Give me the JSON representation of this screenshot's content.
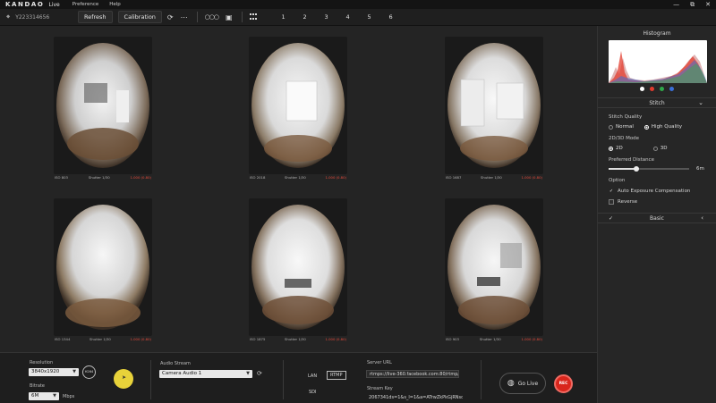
{
  "app": {
    "logo": "KANDAO",
    "product": "Live"
  },
  "menu": [
    "Preference",
    "Help"
  ],
  "window_controls": [
    "minimize-icon",
    "restore-icon",
    "close-icon"
  ],
  "toolbar": {
    "device_id": "Y223314656",
    "refresh_label": "Refresh",
    "calibration_label": "Calibration",
    "camera_tabs": [
      "1",
      "2",
      "3",
      "4",
      "5",
      "6"
    ]
  },
  "cameras": [
    {
      "iso": "ISO 803",
      "shutter": "Shutter 1/30",
      "status": "1.000 (0.80)"
    },
    {
      "iso": "ISO 2018",
      "shutter": "Shutter 1/30",
      "status": "1.000 (0.80)"
    },
    {
      "iso": "ISO 1687",
      "shutter": "Shutter 1/30",
      "status": "1.000 (0.80)"
    },
    {
      "iso": "ISO 1344",
      "shutter": "Shutter 1/30",
      "status": "1.000 (0.80)"
    },
    {
      "iso": "ISO 1875",
      "shutter": "Shutter 1/30",
      "status": "1.000 (0.80)"
    },
    {
      "iso": "ISO 903",
      "shutter": "Shutter 1/30",
      "status": "1.000 (0.80)"
    }
  ],
  "panel": {
    "histogram_title": "Histogram",
    "channel_dots": [
      "#ffffff",
      "#e03b2e",
      "#2fa84a",
      "#3a6fd8"
    ],
    "stitch": {
      "title": "Stitch",
      "quality_label": "Stitch Quality",
      "quality_options": [
        "Normal",
        "High Quality"
      ],
      "quality_selected": "High Quality",
      "mode_label": "2D/3D Mode",
      "mode_options": [
        "2D",
        "3D"
      ],
      "mode_selected": "2D",
      "distance_label": "Preferred Distance",
      "distance_value": "6m",
      "distance_fraction": 0.34,
      "option_label": "Option",
      "auto_exposure_label": "Auto Exposure Compensation",
      "auto_exposure_checked": true,
      "reverse_label": "Reverse",
      "reverse_checked": false
    },
    "basic_title": "Basic"
  },
  "bottom": {
    "resolution_label": "Resolution",
    "resolution_value": "3840x1920",
    "codec_badge": "H264",
    "bitrate_label": "Bitrate",
    "bitrate_value": "6M",
    "bitrate_unit": "Mbps",
    "audio_label": "Audio Stream",
    "audio_value": "Camera Audio 1",
    "stream_lan": "LAN",
    "stream_rtmp": "RTMP",
    "stream_sdi": "SDI",
    "server_url_label": "Server URL",
    "server_url_value": "rtmps://live-360.facebook.com:80/rtmp/",
    "stream_key_label": "Stream Key",
    "stream_key_value": "2067341ds=1&s_l=1&a=ATrwZkPkGjRNsdg5",
    "go_live_label": "Go Live",
    "rec_label": "REC"
  }
}
